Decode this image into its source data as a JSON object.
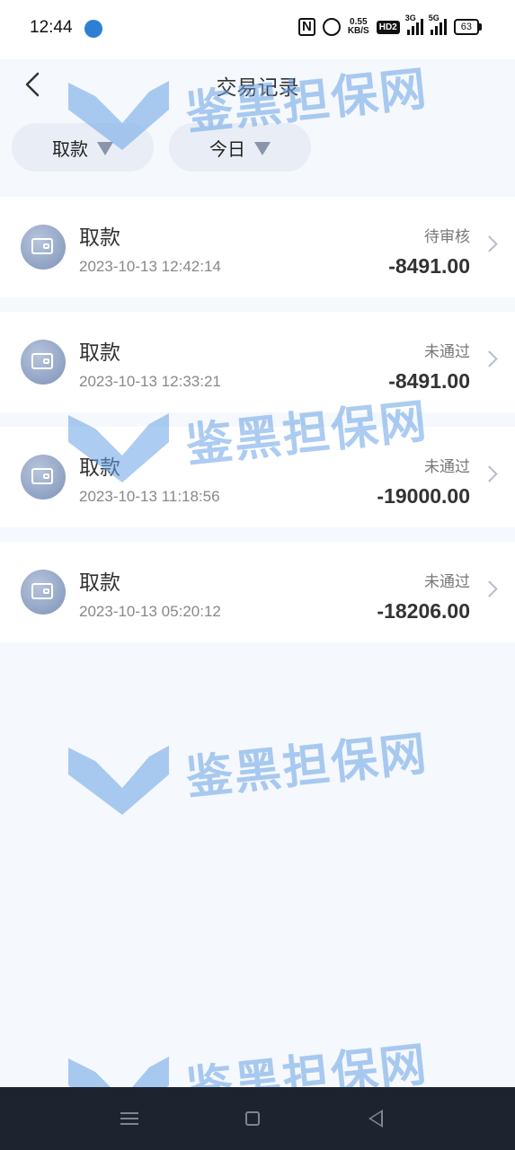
{
  "status_bar": {
    "time": "12:44",
    "speed_value": "0.55",
    "speed_unit": "KB/S",
    "hd_label": "HD2",
    "signal_1_label": "3G",
    "signal_2_label": "5G",
    "battery": "63"
  },
  "header": {
    "title": "交易记录"
  },
  "filters": {
    "type_label": "取款",
    "date_label": "今日"
  },
  "transactions": [
    {
      "title": "取款",
      "time": "2023-10-13 12:42:14",
      "status": "待审核",
      "amount": "-8491.00"
    },
    {
      "title": "取款",
      "time": "2023-10-13 12:33:21",
      "status": "未通过",
      "amount": "-8491.00"
    },
    {
      "title": "取款",
      "time": "2023-10-13 11:18:56",
      "status": "未通过",
      "amount": "-19000.00"
    },
    {
      "title": "取款",
      "time": "2023-10-13 05:20:12",
      "status": "未通过",
      "amount": "-18206.00"
    }
  ],
  "watermark": {
    "text": "鉴黑担保网"
  },
  "colors": {
    "background": "#f5f8fc",
    "card": "#ffffff",
    "navbar": "#1d2430",
    "watermark": "#6aa3e6"
  }
}
